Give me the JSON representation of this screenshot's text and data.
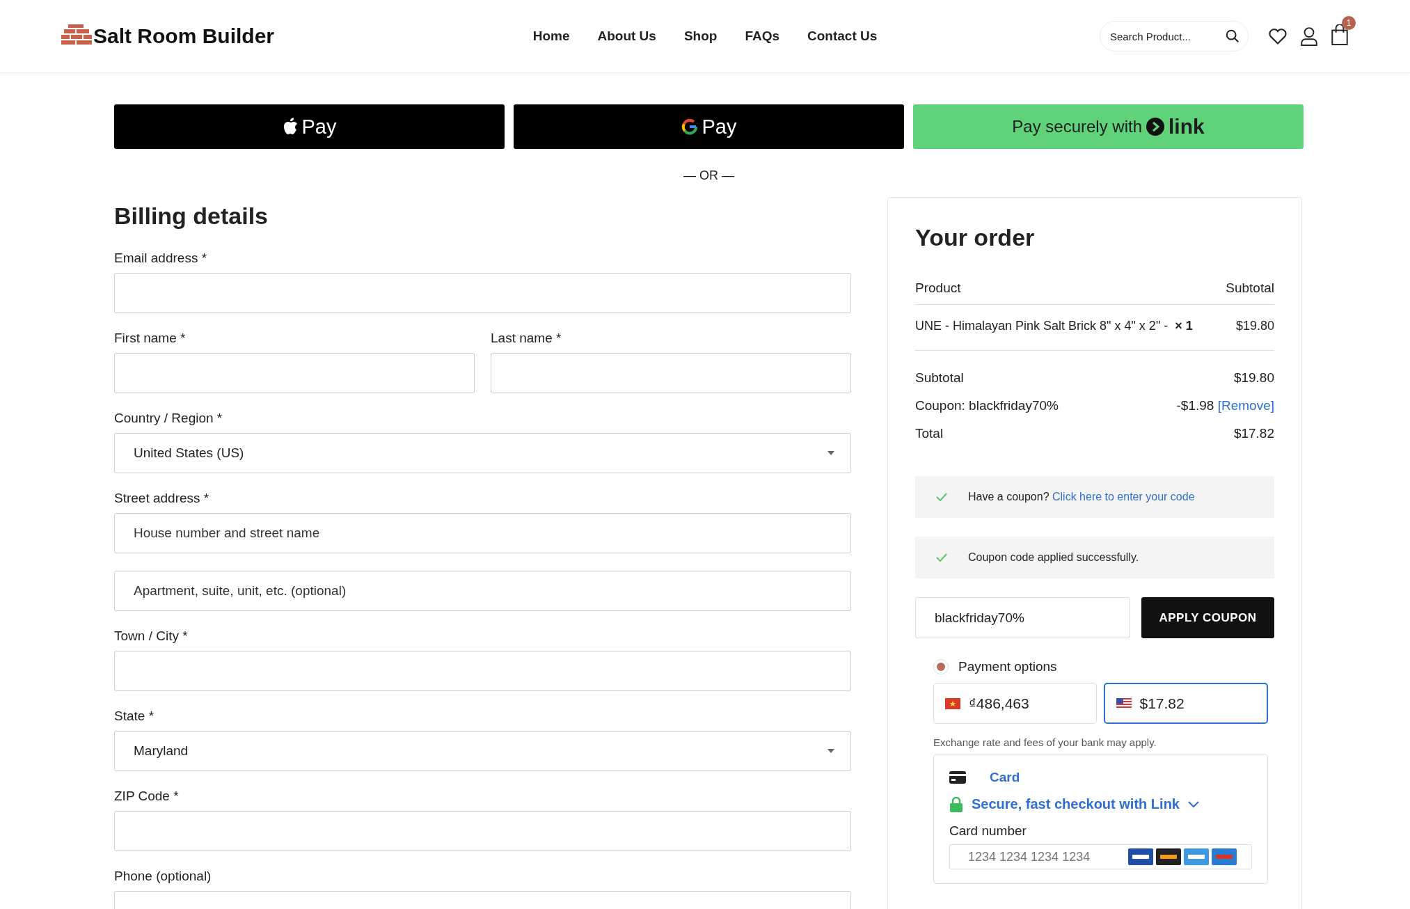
{
  "header": {
    "logo": "Salt Room Builder",
    "nav": [
      {
        "label": "Home"
      },
      {
        "label": "About Us"
      },
      {
        "label": "Shop"
      },
      {
        "label": "FAQs"
      },
      {
        "label": "Contact Us"
      }
    ],
    "search": {
      "placeholder": "Search Product..."
    },
    "cart_count": "1"
  },
  "express_pay": [
    {
      "kind": "apple",
      "label": "Pay"
    },
    {
      "kind": "google",
      "label": "Pay"
    },
    {
      "kind": "link",
      "label": "Pay securely with",
      "brand": "link"
    }
  ],
  "divider": "— OR —",
  "billing": {
    "title": "Billing details",
    "rows": [
      [
        {
          "kind": "input",
          "label": "Email address *"
        }
      ],
      [
        {
          "kind": "input",
          "label": "First name *"
        },
        {
          "kind": "input",
          "label": "Last name *"
        }
      ],
      [
        {
          "kind": "select",
          "label": "Country / Region *",
          "value": "United States (US)"
        }
      ],
      [
        {
          "kind": "input",
          "label": "Street address *",
          "placeholder": "House number and street name"
        }
      ],
      [
        {
          "kind": "input",
          "placeholder": "Apartment, suite, unit, etc. (optional)"
        }
      ],
      [
        {
          "kind": "input",
          "label": "Town / City *"
        }
      ],
      [
        {
          "kind": "select",
          "label": "State *",
          "value": "Maryland"
        }
      ],
      [
        {
          "kind": "input",
          "label": "ZIP Code *"
        }
      ],
      [
        {
          "kind": "input",
          "label": "Phone (optional)"
        }
      ]
    ]
  },
  "order": {
    "title": "Your order",
    "columns": [
      "Product",
      "Subtotal"
    ],
    "items": [
      {
        "name": "UNE - Himalayan Pink Salt Brick 8\" x 4\" x 2\" -",
        "qty": "× 1",
        "price": "$19.80"
      }
    ],
    "totals": [
      {
        "label": "Subtotal",
        "value": "$19.80"
      },
      {
        "label": "Coupon: blackfriday70%",
        "value": "-$1.98",
        "action": "[Remove]"
      },
      {
        "label": "Total",
        "value": "$17.82"
      }
    ],
    "notices": [
      {
        "text": "Have a coupon?",
        "link": "Click here to enter your code"
      },
      {
        "text": "Coupon code applied successfully."
      }
    ],
    "coupon": {
      "value": "blackfriday70%",
      "button": "APPLY COUPON"
    },
    "payment": {
      "label": "Payment options",
      "selected": true,
      "currencies": [
        {
          "kind": "vn",
          "amount": "₫486,463",
          "selected": false
        },
        {
          "kind": "us",
          "amount": "$17.82",
          "selected": true
        }
      ],
      "note": "Exchange rate and fees of your bank may apply.",
      "method": "Card",
      "link_checkout": "Secure, fast checkout with Link",
      "card_number": {
        "label": "Card number",
        "placeholder": "1234 1234 1234 1234"
      }
    }
  }
}
